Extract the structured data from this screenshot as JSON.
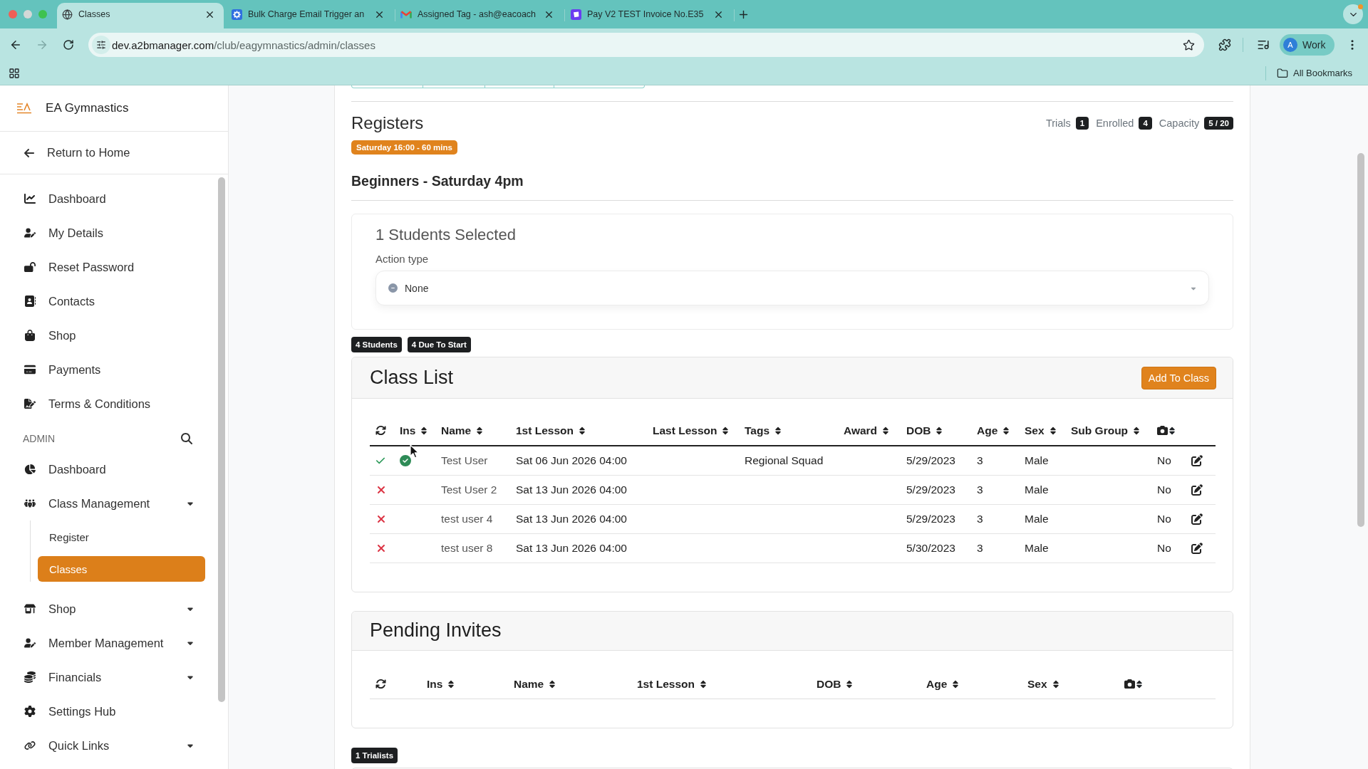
{
  "browser": {
    "tabs": [
      {
        "title": "Classes",
        "selected": true
      },
      {
        "title": "Bulk Charge Email Trigger an",
        "selected": false
      },
      {
        "title": "Assigned Tag - ash@eacoach",
        "selected": false
      },
      {
        "title": "Pay V2 TEST Invoice No.E35",
        "selected": false
      }
    ],
    "address": {
      "host": "dev.a2bmanager.com",
      "path": "/club/eagymnastics/admin/classes"
    },
    "profile": {
      "initial": "A",
      "label": "Work"
    },
    "bookmarks_label": "All Bookmarks"
  },
  "sidebar": {
    "brand": "EA Gymnastics",
    "back_link": "Return to Home",
    "items": [
      {
        "label": "Dashboard",
        "selected": false
      },
      {
        "label": "My Details",
        "selected": false
      },
      {
        "label": "Reset Password",
        "selected": false
      },
      {
        "label": "Contacts",
        "selected": false
      },
      {
        "label": "Shop",
        "selected": false
      },
      {
        "label": "Payments",
        "selected": false
      },
      {
        "label": "Terms & Conditions",
        "selected": false
      }
    ],
    "admin_label": "ADMIN",
    "admin_items": [
      {
        "label": "Dashboard",
        "selected": false,
        "dropdown": false
      },
      {
        "label": "Class Management",
        "selected": false,
        "dropdown": true,
        "children": [
          {
            "label": "Register",
            "selected": false
          },
          {
            "label": "Classes",
            "selected": true
          }
        ]
      },
      {
        "label": "Shop",
        "selected": false,
        "dropdown": true
      },
      {
        "label": "Member Management",
        "selected": false,
        "dropdown": true
      },
      {
        "label": "Financials",
        "selected": false,
        "dropdown": true
      },
      {
        "label": "Settings Hub",
        "selected": false,
        "dropdown": false
      },
      {
        "label": "Quick Links",
        "selected": false,
        "dropdown": true
      }
    ]
  },
  "registers": {
    "title": "Registers",
    "stats": [
      {
        "label": "Trials",
        "value": "1"
      },
      {
        "label": "Enrolled",
        "value": "4"
      },
      {
        "label": "Capacity",
        "value": "5 / 20"
      }
    ],
    "schedule_badge": "Saturday 16:00 - 60 mins",
    "class_name": "Beginners - Saturday 4pm"
  },
  "selection": {
    "title": "1 Students Selected",
    "action_label": "Action type",
    "action_value": "None"
  },
  "count_badges": [
    "4 Students",
    "4 Due To Start"
  ],
  "class_list": {
    "title": "Class List",
    "add_button": "Add To Class",
    "columns": [
      {
        "kind": "sync",
        "sortable": false
      },
      {
        "kind": "text",
        "label": "Ins",
        "sortable": true
      },
      {
        "kind": "text",
        "label": "Name",
        "sortable": true
      },
      {
        "kind": "text",
        "label": "1st Lesson",
        "sortable": true
      },
      {
        "kind": "text",
        "label": "Last Lesson",
        "sortable": true
      },
      {
        "kind": "text",
        "label": "Tags",
        "sortable": true
      },
      {
        "kind": "text",
        "label": "Award",
        "sortable": true
      },
      {
        "kind": "text",
        "label": "DOB",
        "sortable": true
      },
      {
        "kind": "text",
        "label": "Age",
        "sortable": true
      },
      {
        "kind": "text",
        "label": "Sex",
        "sortable": true
      },
      {
        "kind": "text",
        "label": "Sub Group",
        "sortable": true
      },
      {
        "kind": "photo",
        "sortable": true
      }
    ],
    "rows": [
      {
        "present": true,
        "ins": true,
        "name": "Test User",
        "first_lesson": "Sat 06 Jun 2026 04:00",
        "tags": "Regional Squad",
        "dob": "5/29/2023",
        "age": "3",
        "sex": "Male",
        "photo": "No"
      },
      {
        "present": false,
        "ins": false,
        "name": "Test User 2",
        "first_lesson": "Sat 13 Jun 2026 04:00",
        "dob": "5/29/2023",
        "age": "3",
        "sex": "Male",
        "photo": "No"
      },
      {
        "present": false,
        "ins": false,
        "name": "test user 4",
        "first_lesson": "Sat 13 Jun 2026 04:00",
        "dob": "5/29/2023",
        "age": "3",
        "sex": "Male",
        "photo": "No"
      },
      {
        "present": false,
        "ins": false,
        "name": "test user 8",
        "first_lesson": "Sat 13 Jun 2026 04:00",
        "dob": "5/30/2023",
        "age": "3",
        "sex": "Male",
        "photo": "No"
      }
    ]
  },
  "pending_invites": {
    "title": "Pending Invites",
    "columns": [
      {
        "kind": "sync",
        "sortable": false
      },
      {
        "kind": "text",
        "label": "Ins",
        "sortable": true
      },
      {
        "kind": "text",
        "label": "Name",
        "sortable": true
      },
      {
        "kind": "text",
        "label": "1st Lesson",
        "sortable": true
      },
      {
        "kind": "text",
        "label": "DOB",
        "sortable": true
      },
      {
        "kind": "text",
        "label": "Age",
        "sortable": true
      },
      {
        "kind": "text",
        "label": "Sex",
        "sortable": true
      },
      {
        "kind": "photo",
        "sortable": true
      }
    ]
  },
  "trialists_badge": "1 Trialists"
}
